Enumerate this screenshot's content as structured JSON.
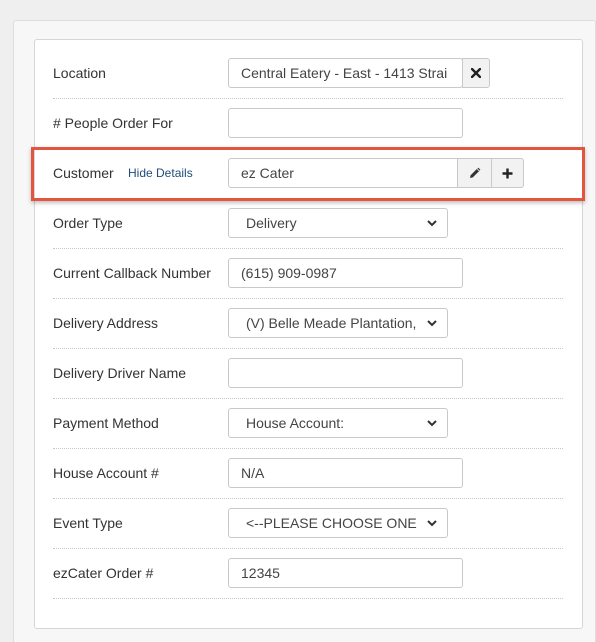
{
  "form": {
    "location": {
      "label": "Location",
      "value": "Central Eatery - East - 1413 Strai",
      "clear_icon": "times-icon"
    },
    "people": {
      "label": "# People Order For",
      "value": ""
    },
    "customer": {
      "label": "Customer",
      "link": "Hide Details",
      "value": "ez Cater",
      "edit_icon": "pencil-icon",
      "add_icon": "plus-icon"
    },
    "order_type": {
      "label": "Order Type",
      "value": "Delivery"
    },
    "callback": {
      "label": "Current Callback Number",
      "value": "(615) 909-0987"
    },
    "delivery_address": {
      "label": "Delivery Address",
      "value": "(V) Belle Meade Plantation,"
    },
    "driver": {
      "label": "Delivery Driver Name",
      "value": ""
    },
    "payment": {
      "label": "Payment Method",
      "value": "House Account:"
    },
    "house_account": {
      "label": "House Account #",
      "value": "N/A"
    },
    "event_type": {
      "label": "Event Type",
      "value": "<--PLEASE CHOOSE ONE"
    },
    "ezcater_order": {
      "label": "ezCater Order #",
      "value": "12345"
    }
  },
  "colors": {
    "highlight_border": "#e2553f",
    "link": "#1f4d7a",
    "page_bg": "#efefef"
  }
}
